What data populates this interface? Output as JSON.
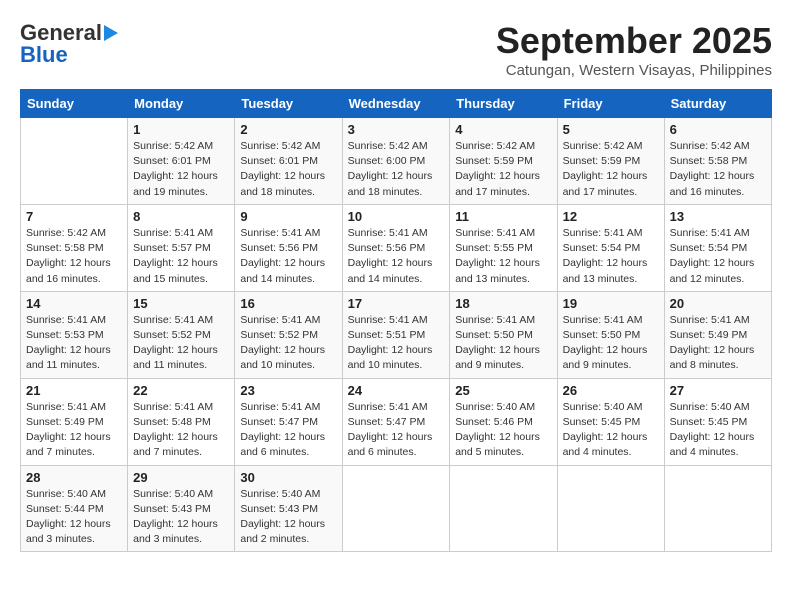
{
  "header": {
    "logo_general": "General",
    "logo_blue": "Blue",
    "month_title": "September 2025",
    "location": "Catungan, Western Visayas, Philippines"
  },
  "columns": [
    "Sunday",
    "Monday",
    "Tuesday",
    "Wednesday",
    "Thursday",
    "Friday",
    "Saturday"
  ],
  "weeks": [
    [
      {
        "day": "",
        "info": ""
      },
      {
        "day": "1",
        "info": "Sunrise: 5:42 AM\nSunset: 6:01 PM\nDaylight: 12 hours\nand 19 minutes."
      },
      {
        "day": "2",
        "info": "Sunrise: 5:42 AM\nSunset: 6:01 PM\nDaylight: 12 hours\nand 18 minutes."
      },
      {
        "day": "3",
        "info": "Sunrise: 5:42 AM\nSunset: 6:00 PM\nDaylight: 12 hours\nand 18 minutes."
      },
      {
        "day": "4",
        "info": "Sunrise: 5:42 AM\nSunset: 5:59 PM\nDaylight: 12 hours\nand 17 minutes."
      },
      {
        "day": "5",
        "info": "Sunrise: 5:42 AM\nSunset: 5:59 PM\nDaylight: 12 hours\nand 17 minutes."
      },
      {
        "day": "6",
        "info": "Sunrise: 5:42 AM\nSunset: 5:58 PM\nDaylight: 12 hours\nand 16 minutes."
      }
    ],
    [
      {
        "day": "7",
        "info": "Sunrise: 5:42 AM\nSunset: 5:58 PM\nDaylight: 12 hours\nand 16 minutes."
      },
      {
        "day": "8",
        "info": "Sunrise: 5:41 AM\nSunset: 5:57 PM\nDaylight: 12 hours\nand 15 minutes."
      },
      {
        "day": "9",
        "info": "Sunrise: 5:41 AM\nSunset: 5:56 PM\nDaylight: 12 hours\nand 14 minutes."
      },
      {
        "day": "10",
        "info": "Sunrise: 5:41 AM\nSunset: 5:56 PM\nDaylight: 12 hours\nand 14 minutes."
      },
      {
        "day": "11",
        "info": "Sunrise: 5:41 AM\nSunset: 5:55 PM\nDaylight: 12 hours\nand 13 minutes."
      },
      {
        "day": "12",
        "info": "Sunrise: 5:41 AM\nSunset: 5:54 PM\nDaylight: 12 hours\nand 13 minutes."
      },
      {
        "day": "13",
        "info": "Sunrise: 5:41 AM\nSunset: 5:54 PM\nDaylight: 12 hours\nand 12 minutes."
      }
    ],
    [
      {
        "day": "14",
        "info": "Sunrise: 5:41 AM\nSunset: 5:53 PM\nDaylight: 12 hours\nand 11 minutes."
      },
      {
        "day": "15",
        "info": "Sunrise: 5:41 AM\nSunset: 5:52 PM\nDaylight: 12 hours\nand 11 minutes."
      },
      {
        "day": "16",
        "info": "Sunrise: 5:41 AM\nSunset: 5:52 PM\nDaylight: 12 hours\nand 10 minutes."
      },
      {
        "day": "17",
        "info": "Sunrise: 5:41 AM\nSunset: 5:51 PM\nDaylight: 12 hours\nand 10 minutes."
      },
      {
        "day": "18",
        "info": "Sunrise: 5:41 AM\nSunset: 5:50 PM\nDaylight: 12 hours\nand 9 minutes."
      },
      {
        "day": "19",
        "info": "Sunrise: 5:41 AM\nSunset: 5:50 PM\nDaylight: 12 hours\nand 9 minutes."
      },
      {
        "day": "20",
        "info": "Sunrise: 5:41 AM\nSunset: 5:49 PM\nDaylight: 12 hours\nand 8 minutes."
      }
    ],
    [
      {
        "day": "21",
        "info": "Sunrise: 5:41 AM\nSunset: 5:49 PM\nDaylight: 12 hours\nand 7 minutes."
      },
      {
        "day": "22",
        "info": "Sunrise: 5:41 AM\nSunset: 5:48 PM\nDaylight: 12 hours\nand 7 minutes."
      },
      {
        "day": "23",
        "info": "Sunrise: 5:41 AM\nSunset: 5:47 PM\nDaylight: 12 hours\nand 6 minutes."
      },
      {
        "day": "24",
        "info": "Sunrise: 5:41 AM\nSunset: 5:47 PM\nDaylight: 12 hours\nand 6 minutes."
      },
      {
        "day": "25",
        "info": "Sunrise: 5:40 AM\nSunset: 5:46 PM\nDaylight: 12 hours\nand 5 minutes."
      },
      {
        "day": "26",
        "info": "Sunrise: 5:40 AM\nSunset: 5:45 PM\nDaylight: 12 hours\nand 4 minutes."
      },
      {
        "day": "27",
        "info": "Sunrise: 5:40 AM\nSunset: 5:45 PM\nDaylight: 12 hours\nand 4 minutes."
      }
    ],
    [
      {
        "day": "28",
        "info": "Sunrise: 5:40 AM\nSunset: 5:44 PM\nDaylight: 12 hours\nand 3 minutes."
      },
      {
        "day": "29",
        "info": "Sunrise: 5:40 AM\nSunset: 5:43 PM\nDaylight: 12 hours\nand 3 minutes."
      },
      {
        "day": "30",
        "info": "Sunrise: 5:40 AM\nSunset: 5:43 PM\nDaylight: 12 hours\nand 2 minutes."
      },
      {
        "day": "",
        "info": ""
      },
      {
        "day": "",
        "info": ""
      },
      {
        "day": "",
        "info": ""
      },
      {
        "day": "",
        "info": ""
      }
    ]
  ]
}
